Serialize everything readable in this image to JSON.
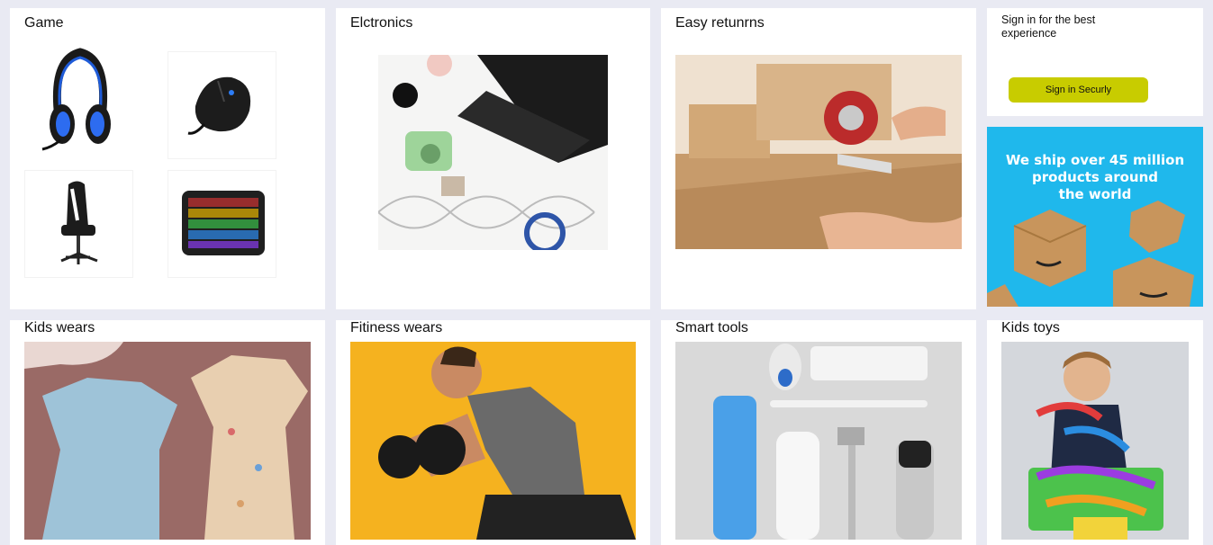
{
  "cards": {
    "game": {
      "title": "Game"
    },
    "electronics": {
      "title": "Elctronics"
    },
    "returns": {
      "title": "Easy retunrns"
    },
    "kids_wears": {
      "title": "Kids wears"
    },
    "fitness_wears": {
      "title": "Fitiness wears"
    },
    "smart_tools": {
      "title": "Smart tools"
    },
    "kids_toys": {
      "title": "Kids toys"
    }
  },
  "signin": {
    "prompt": "Sign in for the best experience",
    "button_label": "Sign in Securly"
  },
  "promo": {
    "text_line1": "We ship over 45 million",
    "text_line2": "products around",
    "text_line3": "the world"
  },
  "colors": {
    "page_bg": "#e9eaf3",
    "signin_button": "#c8cc00",
    "promo_bg": "#1fb8ec"
  }
}
